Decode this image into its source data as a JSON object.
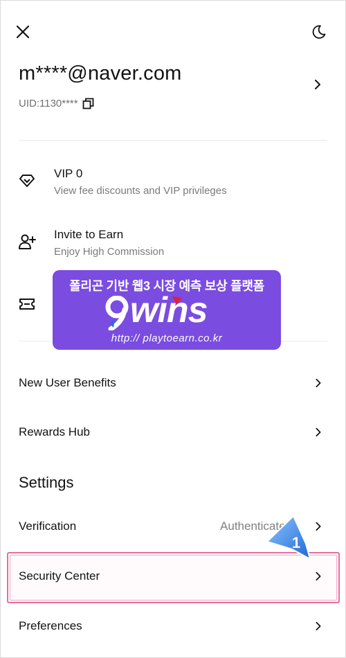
{
  "header": {
    "close_icon": "close-icon",
    "theme_icon": "moon-icon"
  },
  "account": {
    "email": "m****@naver.com",
    "uid": "UID:1130****"
  },
  "promo_items": [
    {
      "icon": "diamond-icon",
      "title": "VIP 0",
      "subtitle": "View fee discounts and VIP privileges"
    },
    {
      "icon": "add-user-icon",
      "title": "Invite to Earn",
      "subtitle": "Enjoy High Commission"
    },
    {
      "icon": "ticket-icon",
      "title": "",
      "subtitle": ""
    }
  ],
  "list": {
    "new_user_benefits": "New User Benefits",
    "rewards_hub": "Rewards Hub"
  },
  "settings": {
    "title": "Settings",
    "verification": {
      "label": "Verification",
      "status": "Authenticated"
    },
    "security_center": {
      "label": "Security Center"
    },
    "preferences": {
      "label": "Preferences"
    }
  },
  "overlay": {
    "banner_headline": "폴리곤 기반 웹3 시장 예측 보상 플랫폼",
    "banner_logo": "9wins",
    "banner_url": "http:// playtoearn.co.kr",
    "step_badge": "1",
    "highlight_color": "#e56f9c",
    "banner_color": "#7b4ce0",
    "badge_color": "#2f7fe6"
  }
}
